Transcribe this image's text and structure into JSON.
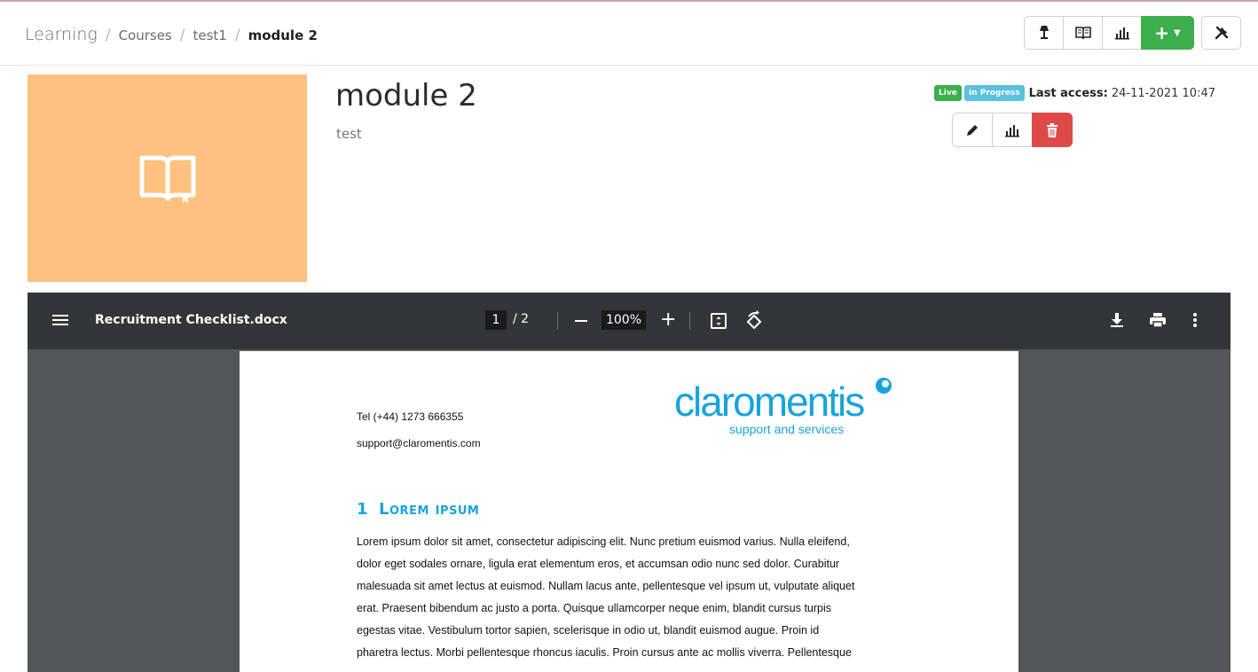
{
  "breadcrumb": {
    "root": "Learning",
    "courses": "Courses",
    "course": "test1",
    "current": "module 2",
    "separator": "/"
  },
  "toolbar": {
    "icons": [
      "lamp-icon",
      "book-icon",
      "bar-chart-icon",
      "plus-icon",
      "tools-icon"
    ],
    "add_label": "+",
    "accent_color": "#3cae4b"
  },
  "module": {
    "title": "module 2",
    "description": "test",
    "thumbnail_color": "#fec17f",
    "badges": {
      "live": "Live",
      "progress": "In Progress"
    },
    "last_access_label": "Last access:",
    "last_access_value": "24-11-2021 10:47"
  },
  "viewer": {
    "filename": "Recruitment Checklist.docx",
    "page_current": "1",
    "page_total": "/  2",
    "zoom": "100%"
  },
  "document": {
    "tel": "Tel (+44) 1273 666355",
    "email": "support@claromentis.com",
    "logo_main": "claromentis",
    "logo_sub": "support and services",
    "heading_number": "1",
    "heading_text": "Lorem ipsum",
    "lines": [
      "Lorem ipsum dolor sit amet, consectetur adipiscing elit. Nunc pretium euismod varius. Nulla eleifend,",
      "dolor eget sodales ornare, ligula erat elementum eros, et accumsan odio nunc sed dolor. Curabitur",
      "malesuada sit amet lectus at euismod. Nullam lacus ante, pellentesque vel ipsum ut, vulputate aliquet",
      "erat. Praesent bibendum ac justo a porta. Quisque ullamcorper neque enim, blandit cursus turpis",
      "egestas vitae. Vestibulum tortor sapien, scelerisque in odio ut, blandit euismod augue. Proin id",
      "pharetra lectus. Morbi pellentesque rhoncus iaculis. Proin cursus ante ac mollis viverra. Pellentesque"
    ]
  }
}
